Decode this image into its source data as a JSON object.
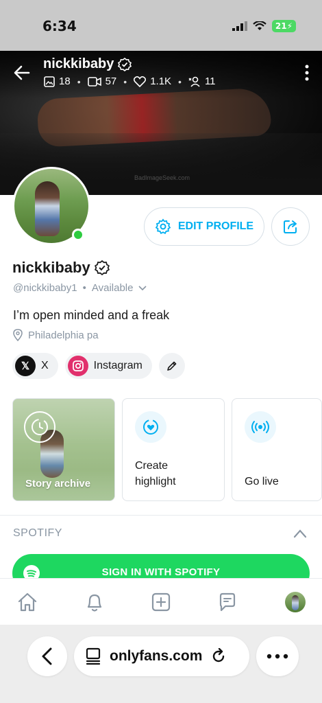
{
  "status_bar": {
    "time": "6:34",
    "battery": "21",
    "icons": [
      "signal-icon",
      "wifi-icon",
      "battery-icon"
    ]
  },
  "cover": {
    "name": "nickkibaby",
    "stats": {
      "photos": "18",
      "videos": "57",
      "likes": "1.1K",
      "fans": "11"
    },
    "watermark": "BadImageSeek.com",
    "icons": [
      "back-arrow-icon",
      "verified-badge-icon",
      "image-icon",
      "video-icon",
      "heart-icon",
      "person-icon",
      "more-vertical-icon"
    ]
  },
  "profile": {
    "edit_label": "EDIT PROFILE",
    "name": "nickkibaby",
    "handle": "@nickkibaby1",
    "availability": "Available",
    "bio": "I’m open minded and a freak",
    "location": "Philadelphia pa",
    "online": true
  },
  "social": [
    {
      "label": "X",
      "icon": "x-logo-icon"
    },
    {
      "label": "Instagram",
      "icon": "instagram-icon"
    }
  ],
  "highlights": [
    {
      "label": "Story archive",
      "icon": "clock-icon"
    },
    {
      "label": "Create\nhighlight",
      "line1": "Create",
      "line2": "highlight",
      "icon": "heart-plus-icon"
    },
    {
      "label": "Go live",
      "icon": "broadcast-icon"
    }
  ],
  "spotify": {
    "header": "SPOTIFY",
    "button": "SIGN IN WITH SPOTIFY"
  },
  "bottom_nav": [
    "home-icon",
    "bell-icon",
    "add-post-icon",
    "messages-icon",
    "profile-avatar"
  ],
  "browser": {
    "url": "onlyfans.com"
  },
  "colors": {
    "accent": "#00aff0",
    "online": "#2ecc40",
    "spotify": "#1ed760",
    "instagram": "#e1306c"
  }
}
